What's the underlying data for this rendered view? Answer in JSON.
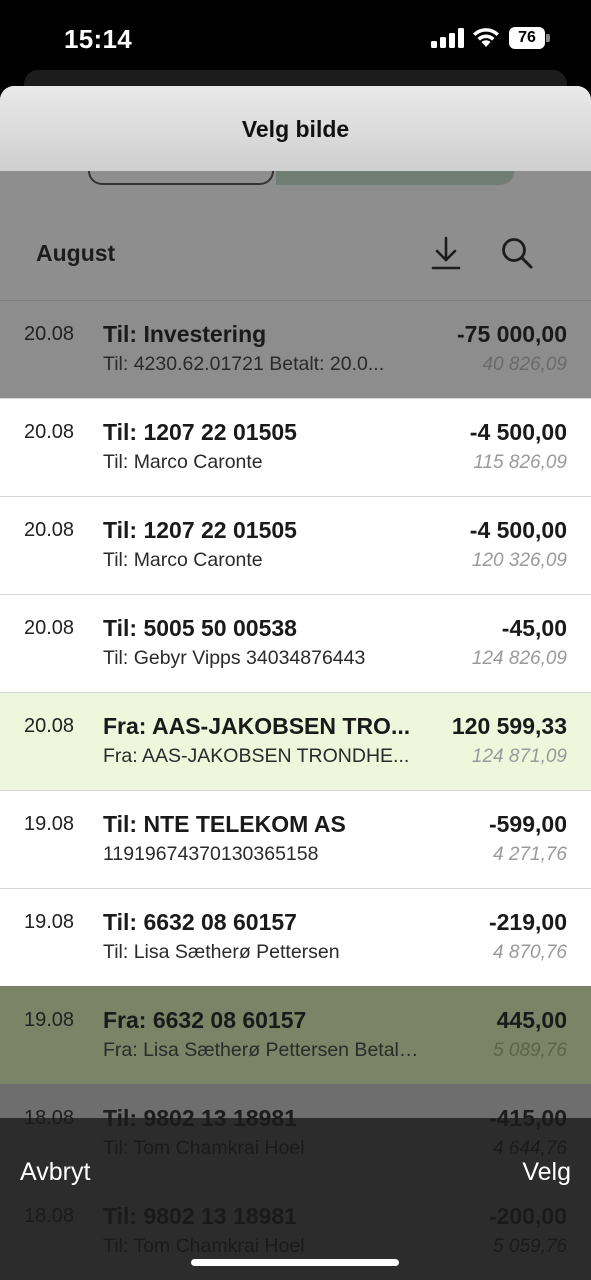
{
  "status_bar": {
    "time": "15:14",
    "battery": "76",
    "icons": [
      "signal-icon",
      "wifi-icon",
      "battery-icon"
    ]
  },
  "modal": {
    "title": "Velg bilde"
  },
  "month": {
    "title": "August",
    "icons": [
      "download-icon",
      "search-icon"
    ]
  },
  "transactions": [
    {
      "date": "20.08",
      "title": "Til: Investering",
      "sub": "Til: 4230.62.01721 Betalt: 20.0...",
      "amount": "-75 000,00",
      "balance": "40 826,09",
      "state": "dimmed"
    },
    {
      "date": "20.08",
      "title": "Til: 1207 22 01505",
      "sub": "Til: Marco Caronte",
      "amount": "-4 500,00",
      "balance": "115 826,09",
      "state": "normal"
    },
    {
      "date": "20.08",
      "title": "Til: 1207 22 01505",
      "sub": "Til: Marco Caronte",
      "amount": "-4 500,00",
      "balance": "120 326,09",
      "state": "normal"
    },
    {
      "date": "20.08",
      "title": "Til: 5005 50 00538",
      "sub": "Til: Gebyr Vipps 34034876443",
      "amount": "-45,00",
      "balance": "124 826,09",
      "state": "normal"
    },
    {
      "date": "20.08",
      "title": "Fra: AAS-JAKOBSEN TRO...",
      "sub": "Fra: AAS-JAKOBSEN TRONDHE...",
      "amount": "120 599,33",
      "balance": "124 871,09",
      "state": "highlight"
    },
    {
      "date": "19.08",
      "title": "Til: NTE TELEKOM AS",
      "sub": "11919674370130365158",
      "amount": "-599,00",
      "balance": "4 271,76",
      "state": "normal"
    },
    {
      "date": "19.08",
      "title": "Til: 6632 08 60157",
      "sub": "Til: Lisa Sætherø Pettersen",
      "amount": "-219,00",
      "balance": "4 870,76",
      "state": "normal"
    },
    {
      "date": "19.08",
      "title": "Fra: 6632 08 60157",
      "sub": "Fra: Lisa Sætherø Pettersen Betalt:...",
      "amount": "445,00",
      "balance": "5 089,76",
      "state": "olive"
    },
    {
      "date": "18.08",
      "title": "Til: 9802 13 18981",
      "sub": "Til: Tom Chamkrai Hoel",
      "amount": "-415,00",
      "balance": "4 644,76",
      "state": "dark"
    },
    {
      "date": "18.08",
      "title": "Til: 9802 13 18981",
      "sub": "Til: Tom Chamkrai Hoel",
      "amount": "-200,00",
      "balance": "5 059,76",
      "state": "dark"
    }
  ],
  "bottom_bar": {
    "cancel_label": "Avbryt",
    "select_label": "Velg"
  }
}
